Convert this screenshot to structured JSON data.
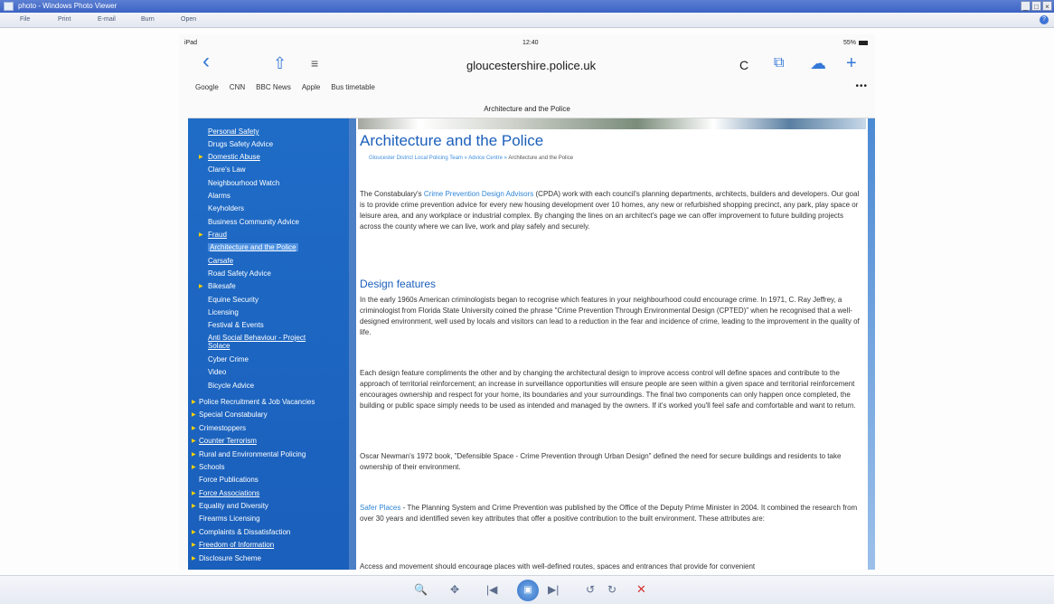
{
  "window": {
    "title": "photo - Windows Photo Viewer",
    "controls": [
      "_",
      "□",
      "×"
    ]
  },
  "menu": {
    "items": [
      "File",
      "Print",
      "E-mail",
      "Burn",
      "Open"
    ],
    "help": "?"
  },
  "ipad": {
    "status": {
      "carrier": "iPad",
      "time": "12:40",
      "battery": "55%"
    },
    "toolbar": {
      "back": "‹",
      "share": "⇧",
      "reader": "≡",
      "url": "gloucestershire.police.uk",
      "reload": "C",
      "bookmarks_btn": "⧉",
      "cloud": "☁",
      "new_tab": "+"
    },
    "bookmarks": [
      "Google",
      "CNN",
      "BBC News",
      "Apple",
      "Bus timetable"
    ],
    "bookmarks_more": "•••",
    "tab_title": "Architecture and the Police"
  },
  "nav": {
    "sub_items": [
      "Personal Safety",
      "Drugs Safety Advice",
      "Domestic Abuse",
      "Clare's Law",
      "Neighbourhood Watch",
      "Alarms",
      "Keyholders",
      "Business Community Advice",
      "Fraud",
      "Architecture and the Police",
      "Carsafe",
      "Road Safety Advice",
      "Bikesafe",
      "Equine Security",
      "Licensing",
      "Festival & Events",
      "Anti Social Behaviour - Project",
      "Solace",
      "Cyber Crime",
      "Video",
      "Bicycle Advice"
    ],
    "top_items": [
      "Police Recruitment & Job Vacancies",
      "Special Constabulary",
      "Crimestoppers",
      "Counter Terrorism",
      "Rural and Environmental Policing",
      "Schools",
      "Force Publications",
      "Force Associations",
      "Equality and Diversity",
      "Firearms Licensing",
      "Complaints & Dissatisfaction",
      "Freedom of Information",
      "Disclosure Scheme"
    ]
  },
  "content": {
    "title": "Architecture and the Police",
    "breadcrumb": {
      "part1": "Gloucester District Local Policing Team",
      "sep": "»",
      "part2": "Advice Centre",
      "current": "Architecture and the Police"
    },
    "p1_before": "The Constabulary's ",
    "p1_link": "Crime Prevention Design Advisors",
    "p1_after": " (CPDA) work with each council's planning departments, architects, builders and developers. Our goal is to provide crime prevention advice for every new housing development over 10 homes, any new or refurbished shopping precinct, any park, play space or leisure area, and any workplace or industrial complex. By changing the lines on an architect's page we can offer improvement to future building projects across the county where we can live, work and play safely and securely.",
    "h_design": "Design features",
    "p2": "In the early 1960s American criminologists began to recognise which features in your neighbourhood could encourage crime. In 1971, C. Ray Jeffrey, a criminologist from Florida State University coined the phrase \"Crime Prevention Through Environmental Design (CPTED)\" when he recognised that a well-designed environment, well used by locals and visitors can lead to a reduction in the fear and incidence of crime, leading to the improvement in the quality of life.",
    "p3": "Each design feature compliments the other and by changing the architectural design to improve access control will define spaces and contribute to the approach of territorial reinforcement; an increase in surveillance opportunities will ensure people are seen within a given space and territorial reinforcement encourages ownership and respect for your home, its boundaries and your surroundings. The final two components can only happen once completed, the building or public space simply needs to be used as intended and managed by the owners. If it's worked you'll feel safe and comfortable and want to return.",
    "p4": "Oscar Newman's 1972 book, \"Defensible Space - Crime Prevention through Urban Design\" defined the need for secure buildings and residents to take ownership of their environment.",
    "p5_link": "Safer Places",
    "p5_after": " - The Planning System and Crime Prevention was published by the Office of the Deputy Prime Minister in 2004. It combined the research from over 30 years and identified seven key attributes that offer a positive contribution to the built environment. These attributes are:",
    "p6": "Access and movement should encourage places with well-defined routes, spaces and entrances that provide for convenient"
  },
  "viewer": {
    "zoom": "🔍",
    "fit": "✥",
    "prev": "|◀",
    "play": "▣",
    "next": "▶|",
    "rotate_ccw": "↺",
    "rotate_cw": "↻",
    "delete": "✕"
  }
}
